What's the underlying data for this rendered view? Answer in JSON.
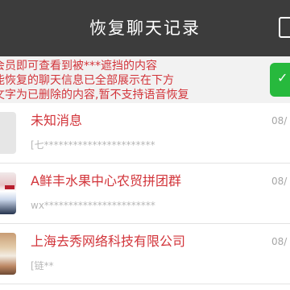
{
  "header": {
    "title": "恢复聊天记录"
  },
  "notice": {
    "lines": [
      "会员即可查看到被***遮挡的内容",
      "能恢复的聊天信息已全部展示在下方",
      "文字为已删除的内容,暂不支持语音恢复"
    ]
  },
  "chats": [
    {
      "name": "未知消息",
      "preview": "[七***********************",
      "date": "08/"
    },
    {
      "name": "A鲜丰水果中心农贸拼团群",
      "preview": "wx***********************",
      "date": "08/"
    },
    {
      "name": "上海去秀网络科技有限公司",
      "preview": "[链**",
      "date": "08/"
    }
  ],
  "colors": {
    "header_bg": "#3c3c3c",
    "accent_red": "#d2343a",
    "green": "#27b93d"
  }
}
